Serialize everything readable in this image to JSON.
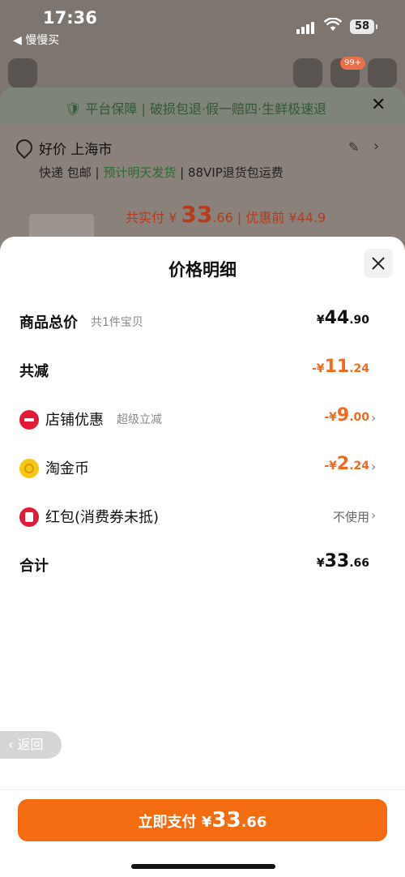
{
  "status": {
    "time": "17:36",
    "back_app": "◀ 慢慢买",
    "battery": "58"
  },
  "bg": {
    "cart_badge": "99+",
    "guarantee": "🛡 平台保障 | 破损包退·假一赔四·生鲜极速退",
    "close": "✕",
    "address": "好价 上海市",
    "ship_prefix": "快递 包邮 | ",
    "ship_highlight": "预计明天发货",
    "ship_suffix": " | 88VIP退货包运费",
    "paid_label": "共实付 ¥ ",
    "paid_int": "33",
    "paid_dec": ".66",
    "paid_before": " | 优惠前 ¥44.9"
  },
  "sheet": {
    "title": "价格明细",
    "rows": [
      {
        "label": "商品总价",
        "sub": "共1件宝贝",
        "cur": "¥",
        "int": "44",
        "dec": ".90"
      },
      {
        "label": "共减",
        "cur": "-¥",
        "int": "11",
        "dec": ".24"
      },
      {
        "label": "店铺优惠",
        "sub": "超级立减",
        "cur": "-¥",
        "int": "9",
        "dec": ".00"
      },
      {
        "label": "淘金币",
        "cur": "-¥",
        "int": "2",
        "dec": ".24"
      },
      {
        "label": "红包(消费券未抵)",
        "value": "不使用"
      },
      {
        "label": "合计",
        "cur": "¥",
        "int": "33",
        "dec": ".66"
      }
    ]
  },
  "return_label": "返回",
  "pay": {
    "label": "立即支付 ¥",
    "int": "33",
    "dec": ".66"
  }
}
